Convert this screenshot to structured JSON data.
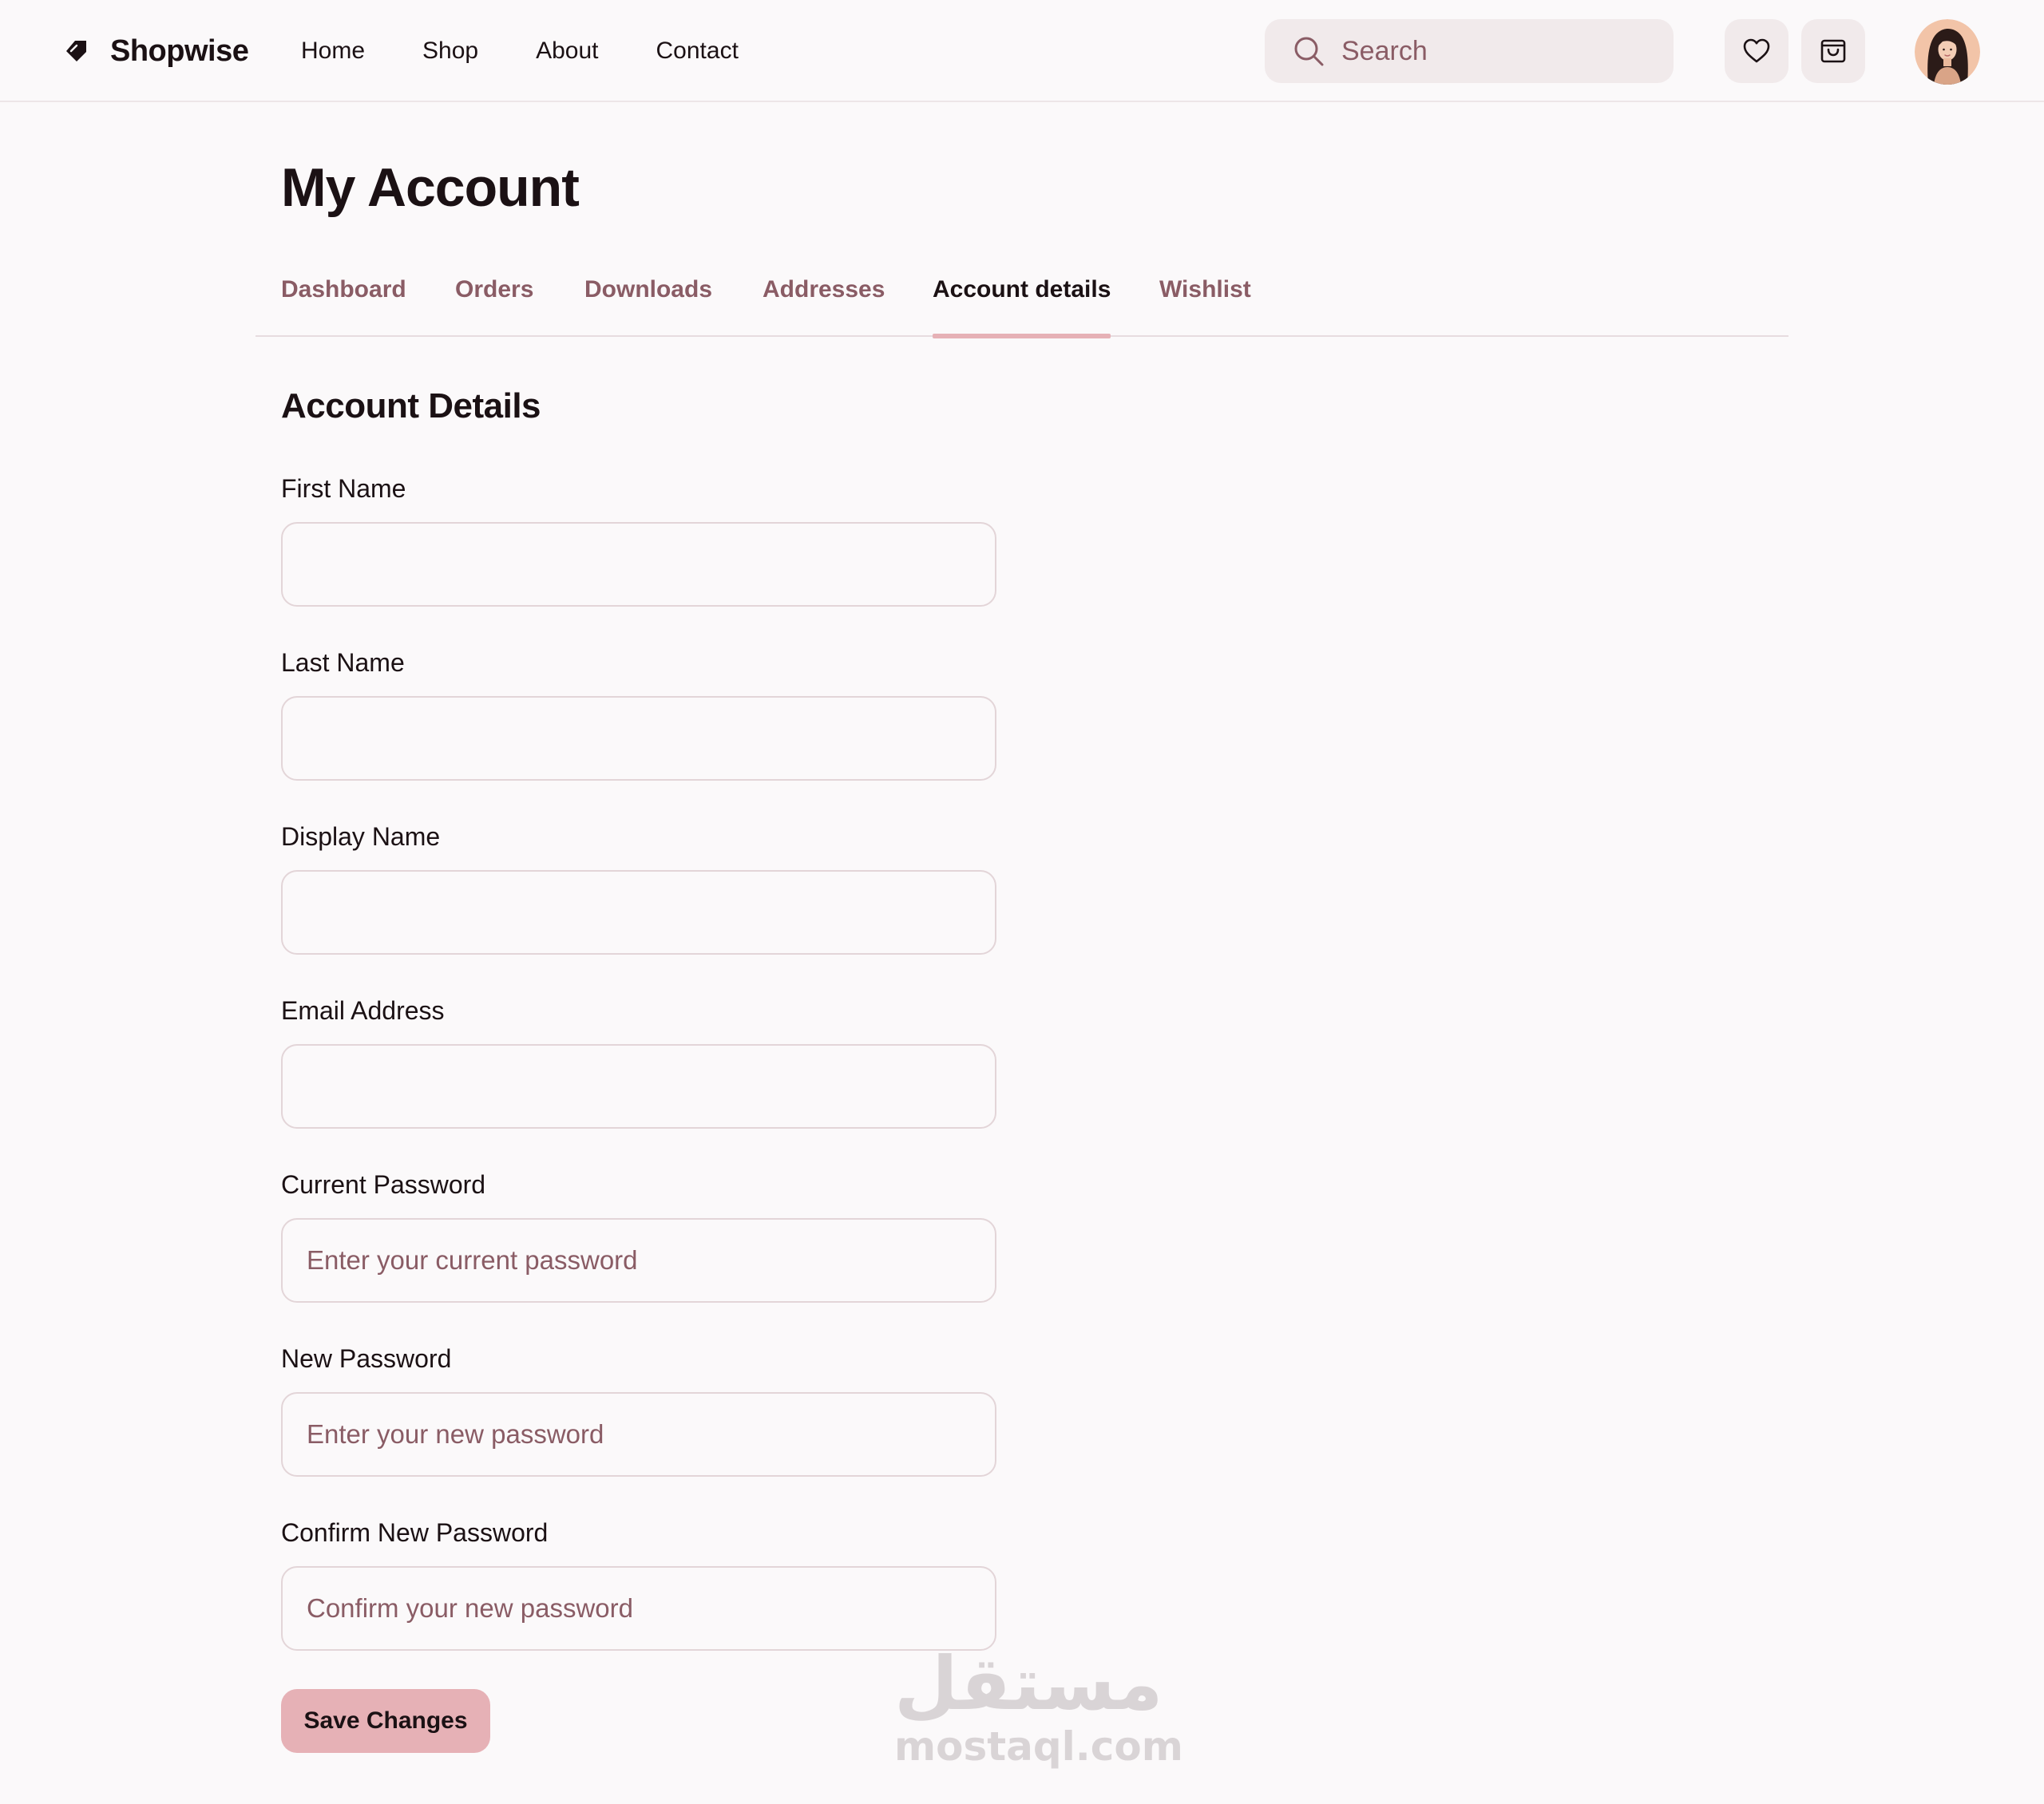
{
  "header": {
    "brand": "Shopwise",
    "nav": [
      "Home",
      "Shop",
      "About",
      "Contact"
    ],
    "search_placeholder": "Search",
    "icons": [
      "heart-icon",
      "cart-icon"
    ]
  },
  "main": {
    "title": "My Account",
    "tabs": [
      "Dashboard",
      "Orders",
      "Downloads",
      "Addresses",
      "Account details",
      "Wishlist"
    ],
    "active_tab": "Account details",
    "section_title": "Account Details",
    "fields": {
      "first_name": {
        "label": "First Name",
        "value": "",
        "placeholder": ""
      },
      "last_name": {
        "label": "Last Name",
        "value": "",
        "placeholder": ""
      },
      "display_name": {
        "label": "Display Name",
        "value": "",
        "placeholder": ""
      },
      "email": {
        "label": "Email Address",
        "value": "",
        "placeholder": ""
      },
      "current_password": {
        "label": "Current Password",
        "value": "",
        "placeholder": "Enter your current password"
      },
      "new_password": {
        "label": "New Password",
        "value": "",
        "placeholder": "Enter your new password"
      },
      "confirm_password": {
        "label": "Confirm New Password",
        "value": "",
        "placeholder": "Confirm your new password"
      }
    },
    "save_label": "Save Changes"
  },
  "watermark": {
    "arabic": "مستقل",
    "latin": "mostaql.com"
  },
  "colors": {
    "background": "#fbf9fa",
    "text": "#1b1114",
    "muted": "#8a5c65",
    "accent": "#e6b1b6",
    "surface": "#f1eaeb",
    "border": "#e3d5d8"
  }
}
